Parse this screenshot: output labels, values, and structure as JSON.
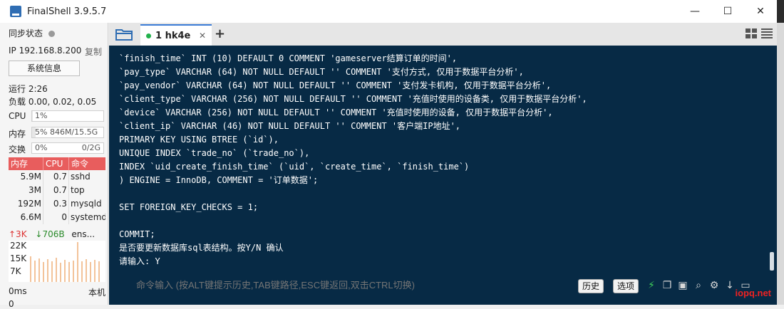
{
  "window": {
    "title": "FinalShell 3.9.5.7",
    "minimize": "—",
    "maximize": "☐",
    "close": "✕"
  },
  "left": {
    "sync_label": "同步状态",
    "ip": "IP 192.168.8.200",
    "copy": "复制",
    "sysinfo_button": "系统信息",
    "uptime": "运行 2:26",
    "load": "负载 0.00, 0.02, 0.05",
    "cpu_label": "CPU",
    "cpu_value": "1%",
    "cpu_fraction": 0.01,
    "mem_label": "内存",
    "mem_value": "5%  846M/15.5G",
    "mem_fraction": 0.05,
    "swap_label": "交换",
    "swap_value": "0%",
    "swap_total": "0/2G",
    "swap_fraction": 0,
    "proc_headers": {
      "mem": "内存",
      "cpu": "CPU",
      "cmd": "命令"
    },
    "processes": [
      {
        "mem": "5.9M",
        "cpu": "0.7",
        "cmd": "sshd"
      },
      {
        "mem": "3M",
        "cpu": "0.7",
        "cmd": "top"
      },
      {
        "mem": "192M",
        "cpu": "0.3",
        "cmd": "mysqld"
      },
      {
        "mem": "6.6M",
        "cpu": "0",
        "cmd": "systemd"
      }
    ],
    "net_up": "↑3K",
    "net_down": "↓706B",
    "net_iface": "ens...",
    "net_ticks": [
      "22K",
      "15K",
      "7K"
    ],
    "latency": "0ms",
    "local": "本机",
    "latency_bottom": "0"
  },
  "tabs": {
    "session": "1 hk4e",
    "close": "✕",
    "add": "+"
  },
  "terminal": {
    "lines": [
      "`finish_time` INT (10) DEFAULT 0 COMMENT 'gameserver结算订单的时间',",
      "`pay_type` VARCHAR (64) NOT NULL DEFAULT '' COMMENT '支付方式, 仅用于数据平台分析',",
      "`pay_vendor` VARCHAR (64) NOT NULL DEFAULT '' COMMENT '支付发卡机构, 仅用于数据平台分析',",
      "`client_type` VARCHAR (256) NOT NULL DEFAULT '' COMMENT '充值时使用的设备类, 仅用于数据平台分析',",
      "`device` VARCHAR (256) NOT NULL DEFAULT '' COMMENT '充值时使用的设备, 仅用于数据平台分析',",
      "`client_ip` VARCHAR (46) NOT NULL DEFAULT '' COMMENT '客户端IP地址',",
      "PRIMARY KEY USING BTREE (`id`),",
      "UNIQUE INDEX `trade_no` (`trade_no`),",
      "INDEX `uid_create_finish_time` (`uid`, `create_time`, `finish_time`)",
      ") ENGINE = InnoDB, COMMENT = '订单数据';",
      "",
      "SET FOREIGN_KEY_CHECKS = 1;",
      "",
      "COMMIT;",
      "是否要更新数据库sql表结构。按Y/N 确认",
      "请输入: Y"
    ]
  },
  "command": {
    "placeholder": "命令输入 (按ALT键提示历史,TAB键路径,ESC键返回,双击CTRL切换)",
    "history": "历史",
    "options": "选项"
  },
  "watermark": "iopq.net",
  "colors": {
    "terminal_bg": "#072a45",
    "accent": "#3a7bd5",
    "proc_header": "#e85d5d"
  }
}
